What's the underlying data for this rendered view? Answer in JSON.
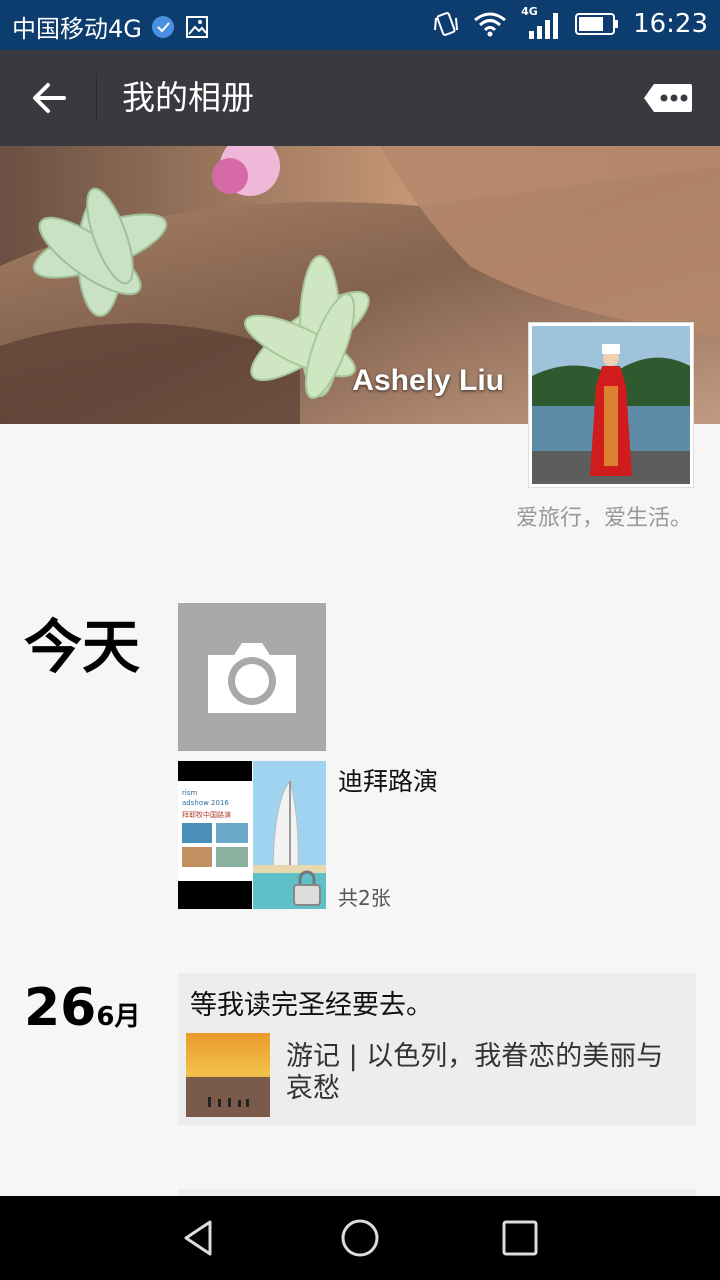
{
  "status_bar": {
    "carrier": "中国移动4G",
    "network_badge": "4G",
    "time": "16:23",
    "icons": [
      "chat-bubble-icon",
      "gallery-icon",
      "vibrate-icon",
      "wifi-icon",
      "signal-icon",
      "battery-icon"
    ]
  },
  "app_bar": {
    "title": "我的相册",
    "back_icon": "back-arrow-icon",
    "more_icon": "more-options-icon"
  },
  "profile": {
    "name": "Ashely Liu",
    "signature": "爱旅行，爱生活。"
  },
  "timeline": {
    "today_label": "今天",
    "camera_icon": "camera-icon",
    "album": {
      "title": "迪拜路演",
      "count": "共2张",
      "thumb_text": "rism\nadshow 2016\n拜耶牧中国路演",
      "lock_icon": "lock-icon"
    },
    "entry": {
      "day": "26",
      "month": "6月",
      "text": "等我读完圣经要去。",
      "link_title": "游记 | 以色列，我眷恋的美丽与哀愁"
    }
  },
  "nav_bar": {
    "icons": [
      "nav-back-icon",
      "nav-home-icon",
      "nav-recents-icon"
    ]
  },
  "colors": {
    "status_bar": "#0c3d6e",
    "app_bar": "#393a3f",
    "background": "#f6f6f6"
  }
}
